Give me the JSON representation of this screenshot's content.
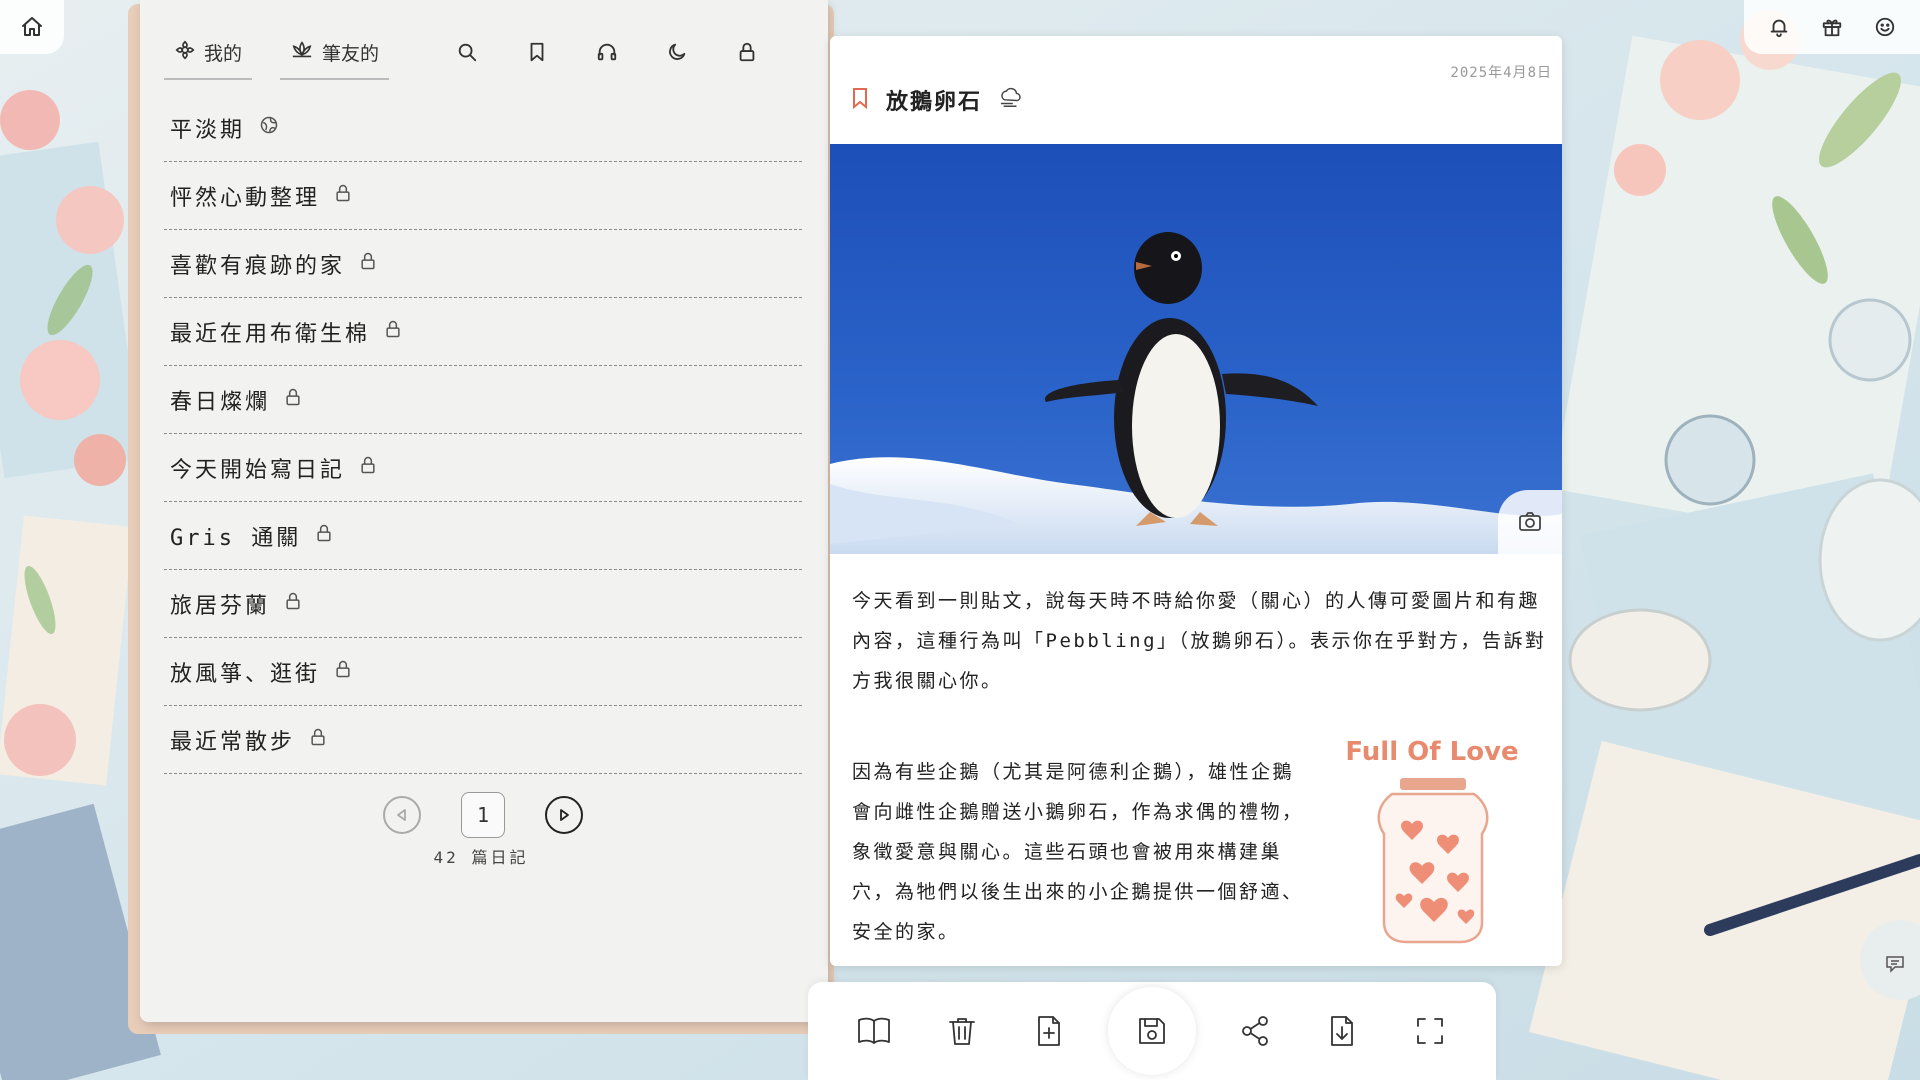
{
  "tabs": {
    "mine_label": "我的",
    "friends_label": "筆友的"
  },
  "entries": [
    {
      "title": "平淡期",
      "icon": "globe-icon"
    },
    {
      "title": "怦然心動整理",
      "icon": "lock-icon"
    },
    {
      "title": "喜歡有痕跡的家",
      "icon": "lock-icon"
    },
    {
      "title": "最近在用布衛生棉",
      "icon": "lock-icon"
    },
    {
      "title": "春日燦爛",
      "icon": "lock-icon"
    },
    {
      "title": "今天開始寫日記",
      "icon": "lock-icon"
    },
    {
      "title": "Gris 通關",
      "icon": "lock-icon"
    },
    {
      "title": "旅居芬蘭",
      "icon": "lock-icon"
    },
    {
      "title": "放風箏、逛街",
      "icon": "lock-icon"
    },
    {
      "title": "最近常散步",
      "icon": "lock-icon"
    }
  ],
  "pager": {
    "current_page": "1",
    "total_entries": "42",
    "count_label": "篇日記"
  },
  "diary": {
    "date": "2025年4月8日",
    "title": "放鵝卵石",
    "weather_icon": "cloud-wind-icon",
    "paragraph1": "今天看到一則貼文，說每天時不時給你愛（關心）的人傳可愛圖片和有趣內容，這種行為叫「Pebbling」（放鵝卵石）。表示你在乎對方，告訴對方我很關心你。",
    "paragraph2": "因為有些企鵝（尤其是阿德利企鵝），雄性企鵝會向雌性企鵝贈送小鵝卵石，作為求偶的禮物，象徵愛意與關心。這些石頭也會被用來構建巢穴，為牠們以後生出來的小企鵝提供一個舒適、安全的家。",
    "sticker_text": "Full Of Love"
  },
  "colors": {
    "accent": "#e26a4e",
    "sticker_text": "#e88a6e",
    "panel_border": "#e8cdb9"
  }
}
